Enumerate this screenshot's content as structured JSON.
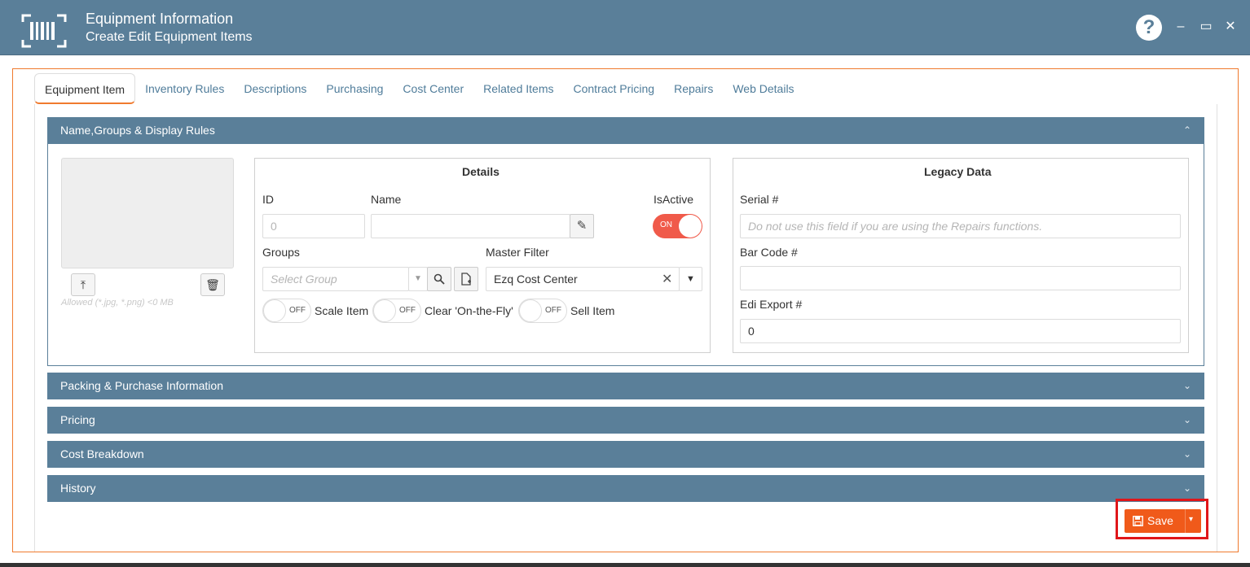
{
  "window": {
    "title": "Equipment Information",
    "subtitle": "Create Edit Equipment Items",
    "help_glyph": "?",
    "minimize_glyph": "–",
    "maximize_glyph": "▭",
    "close_glyph": "✕"
  },
  "tabs": [
    {
      "label": "Equipment Item",
      "active": true
    },
    {
      "label": "Inventory Rules"
    },
    {
      "label": "Descriptions"
    },
    {
      "label": "Purchasing"
    },
    {
      "label": "Cost Center"
    },
    {
      "label": "Related Items"
    },
    {
      "label": "Contract Pricing"
    },
    {
      "label": "Repairs"
    },
    {
      "label": "Web Details"
    }
  ],
  "sections": {
    "name_groups": "Name,Groups & Display Rules",
    "packing": "Packing & Purchase Information",
    "pricing": "Pricing",
    "cost_breakdown": "Cost Breakdown",
    "history": "History",
    "chev_up": "⌃",
    "chev_down": "⌄"
  },
  "image": {
    "upload_glyph": "⤒",
    "delete_glyph": "🗑",
    "hint": "Allowed (*.jpg, *.png) <0 MB"
  },
  "details": {
    "title": "Details",
    "id_label": "ID",
    "id_placeholder": "0",
    "name_label": "Name",
    "name_value": "",
    "isactive_label": "IsActive",
    "isactive_toggle": "ON",
    "groups_label": "Groups",
    "groups_placeholder": "Select Group",
    "master_filter_label": "Master Filter",
    "master_filter_value": "Ezq Cost Center",
    "scale_item_label": "Scale Item",
    "clear_fly_label": "Clear 'On-the-Fly'",
    "sell_item_label": "Sell Item",
    "off_text": "OFF"
  },
  "legacy": {
    "title": "Legacy Data",
    "serial_label": "Serial #",
    "serial_placeholder": "Do not use this field if you are using the Repairs functions.",
    "barcode_label": "Bar Code #",
    "barcode_value": "",
    "edi_label": "Edi Export #",
    "edi_value": "0"
  },
  "footer": {
    "save_label": "Save",
    "save_caret": "▾"
  },
  "colors": {
    "header_bg": "#5a7f99",
    "accent_orange": "#f05a1a",
    "toggle_on": "#f05a4a",
    "highlight_red": "#e0161a"
  }
}
